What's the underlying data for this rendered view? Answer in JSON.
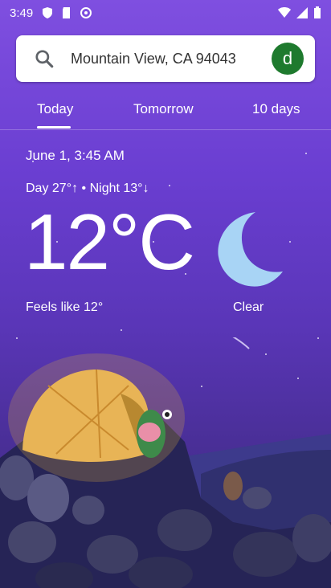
{
  "status": {
    "time": "3:49"
  },
  "search": {
    "location": "Mountain View, CA 94043",
    "avatar_letter": "d"
  },
  "tabs": [
    {
      "label": "Today"
    },
    {
      "label": "Tomorrow"
    },
    {
      "label": "10 days"
    }
  ],
  "weather": {
    "date": "June 1, 3:45 AM",
    "day_night": "Day 27°↑ • Night 13°↓",
    "temperature": "12°C",
    "feels_like": "Feels like 12°",
    "condition": "Clear"
  },
  "colors": {
    "accent_avatar": "#1e7a2e",
    "sky_top": "#7f4fe0",
    "sky_bottom": "#3a2a7a"
  }
}
